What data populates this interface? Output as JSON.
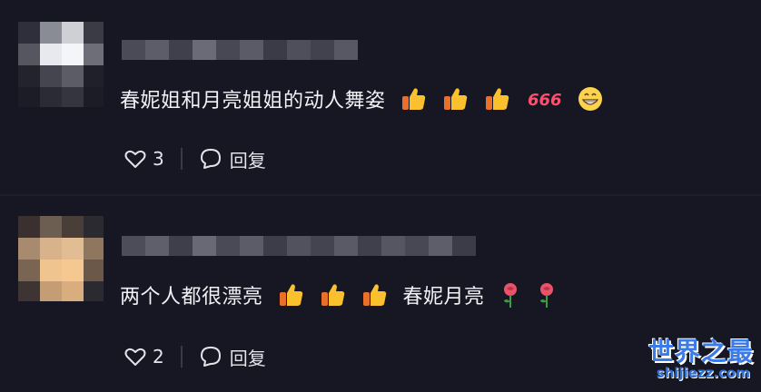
{
  "comments": [
    {
      "text": "春妮姐和月亮姐姐的动人舞姿",
      "text_after": "",
      "likes": "3",
      "reply_label": "回复"
    },
    {
      "text": "两个人都很漂亮",
      "text_after": "春妮月亮",
      "likes": "2",
      "reply_label": "回复"
    }
  ],
  "emoji_labels": {
    "six": "666"
  },
  "watermark": {
    "title": "世界之最",
    "url": "shijiezz.com"
  },
  "colors": {
    "background": "#161722",
    "text": "#f1f2f6",
    "watermark": "#3a7be8"
  }
}
